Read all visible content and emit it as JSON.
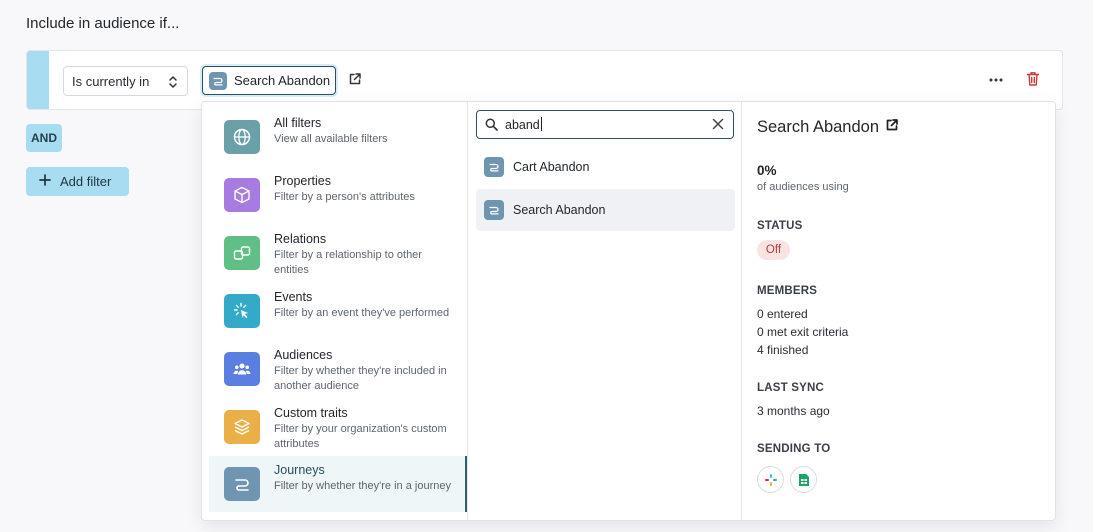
{
  "heading": "Include in audience if...",
  "rule": {
    "condition_select": "Is currently in",
    "selected_chip": "Search Abandon",
    "colors": {
      "accent": "#a8dcf0",
      "delete": "#c73b3b"
    }
  },
  "and_label": "AND",
  "add_filter_label": "Add filter",
  "categories": [
    {
      "title": "All filters",
      "desc": "View all available filters",
      "icon": "globe-icon",
      "color": "#6aa0a8"
    },
    {
      "title": "Properties",
      "desc": "Filter by a person's attributes",
      "icon": "cube-icon",
      "color": "#a77be0"
    },
    {
      "title": "Relations",
      "desc": "Filter by a relationship to other entities",
      "icon": "relations-icon",
      "color": "#5fbf86"
    },
    {
      "title": "Events",
      "desc": "Filter by an event they've performed",
      "icon": "cursor-click-icon",
      "color": "#34aac9"
    },
    {
      "title": "Audiences",
      "desc": "Filter by whether they're included in another audience",
      "icon": "people-icon",
      "color": "#5a7fe0"
    },
    {
      "title": "Custom traits",
      "desc": "Filter by your organization's custom attributes",
      "icon": "layers-icon",
      "color": "#eab047"
    },
    {
      "title": "Journeys",
      "desc": "Filter by whether they're in a journey",
      "icon": "journey-icon",
      "color": "#6f95b0"
    }
  ],
  "search": {
    "value": "aband"
  },
  "results": [
    {
      "label": "Cart Abandon"
    },
    {
      "label": "Search Abandon"
    }
  ],
  "details": {
    "title": "Search Abandon",
    "percent": "0%",
    "percent_caption": "of audiences using",
    "status_label": "STATUS",
    "status_value": "Off",
    "members_label": "MEMBERS",
    "members": [
      "0 entered",
      "0 met exit criteria",
      "4 finished"
    ],
    "last_sync_label": "LAST SYNC",
    "last_sync_value": "3 months ago",
    "sending_to_label": "SENDING TO",
    "destinations": [
      "slack-icon",
      "google-sheets-icon"
    ]
  }
}
